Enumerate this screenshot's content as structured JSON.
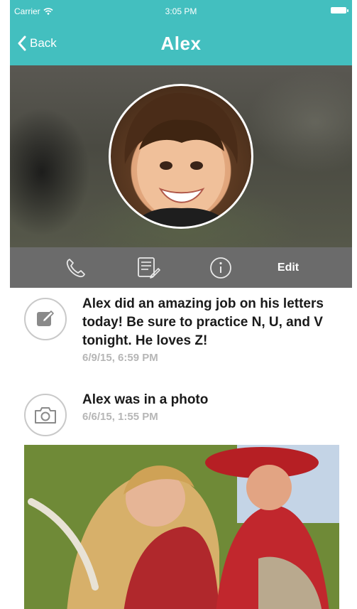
{
  "status_bar": {
    "carrier": "Carrier",
    "time": "3:05 PM"
  },
  "nav": {
    "back_label": "Back",
    "title": "Alex"
  },
  "actions": {
    "edit_label": "Edit"
  },
  "feed": [
    {
      "type": "note",
      "icon": "pencil-note-icon",
      "text": "Alex did an amazing job on his letters today!  Be sure to practice N, U, and V tonight. He loves Z!",
      "timestamp": "6/9/15, 6:59 PM"
    },
    {
      "type": "photo",
      "icon": "camera-icon",
      "text": "Alex was in a photo",
      "timestamp": "6/6/15, 1:55 PM"
    }
  ],
  "colors": {
    "header": "#43bfbf",
    "action_bar": "#6b6b6b",
    "timestamp": "#b6b6b6"
  }
}
